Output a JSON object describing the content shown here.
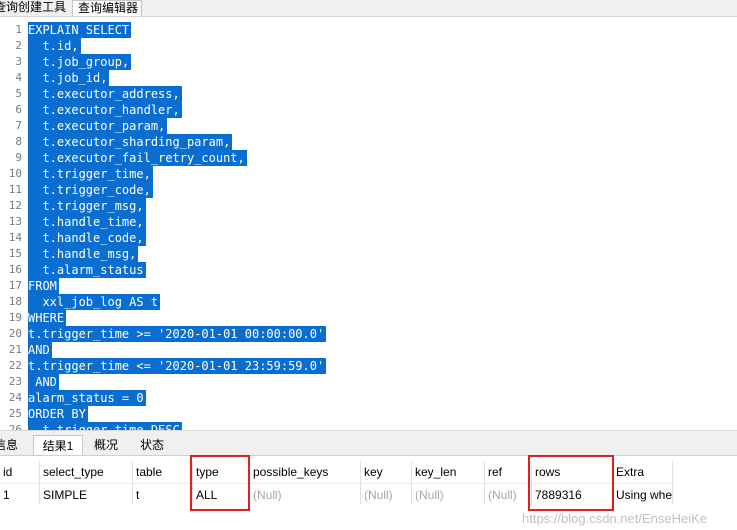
{
  "tabs": {
    "query_builder": "查询创建工具",
    "query_editor": "查询编辑器"
  },
  "editor": {
    "lines": [
      {
        "n": "1",
        "code": "EXPLAIN SELECT"
      },
      {
        "n": "2",
        "code": "  t.id,"
      },
      {
        "n": "3",
        "code": "  t.job_group,"
      },
      {
        "n": "4",
        "code": "  t.job_id,"
      },
      {
        "n": "5",
        "code": "  t.executor_address,"
      },
      {
        "n": "6",
        "code": "  t.executor_handler,"
      },
      {
        "n": "7",
        "code": "  t.executor_param,"
      },
      {
        "n": "8",
        "code": "  t.executor_sharding_param,"
      },
      {
        "n": "9",
        "code": "  t.executor_fail_retry_count,"
      },
      {
        "n": "10",
        "code": "  t.trigger_time,"
      },
      {
        "n": "11",
        "code": "  t.trigger_code,"
      },
      {
        "n": "12",
        "code": "  t.trigger_msg,"
      },
      {
        "n": "13",
        "code": "  t.handle_time,"
      },
      {
        "n": "14",
        "code": "  t.handle_code,"
      },
      {
        "n": "15",
        "code": "  t.handle_msg,"
      },
      {
        "n": "16",
        "code": "  t.alarm_status"
      },
      {
        "n": "17",
        "code": "FROM"
      },
      {
        "n": "18",
        "code": "  xxl_job_log AS t"
      },
      {
        "n": "19",
        "code": "WHERE"
      },
      {
        "n": "20",
        "code": "t.trigger_time >= '2020-01-01 00:00:00.0'"
      },
      {
        "n": "21",
        "code": "AND"
      },
      {
        "n": "22",
        "code": "t.trigger_time <= '2020-01-01 23:59:59.0'"
      },
      {
        "n": "23",
        "code": " AND"
      },
      {
        "n": "24",
        "code": "alarm_status = 0"
      },
      {
        "n": "25",
        "code": "ORDER BY"
      },
      {
        "n": "26",
        "code": "  t.trigger_time DESC"
      }
    ]
  },
  "result_tabs": {
    "info": "信息",
    "result1": "结果1",
    "overview": "概况",
    "status": "状态"
  },
  "grid": {
    "headers": [
      "id",
      "select_type",
      "table",
      "type",
      "possible_keys",
      "key",
      "key_len",
      "ref",
      "rows",
      "Extra"
    ],
    "row": [
      "1",
      "SIMPLE",
      "t",
      "ALL",
      "(Null)",
      "(Null)",
      "(Null)",
      "(Null)",
      "7889316",
      "Using whe"
    ]
  },
  "watermark": "https://blog.csdn.net/EnseHeiKe",
  "colors": {
    "selection": "#0a6ed1",
    "highlight_box": "#e02020"
  }
}
